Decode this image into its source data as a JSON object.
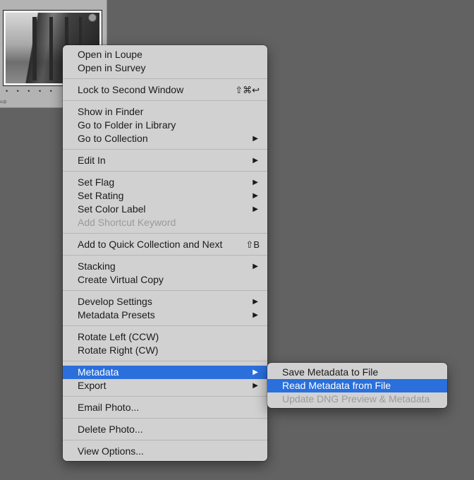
{
  "menu": {
    "groups": [
      [
        {
          "label": "Open in Loupe"
        },
        {
          "label": "Open in Survey"
        }
      ],
      [
        {
          "label": "Lock to Second Window",
          "shortcut": "⇧⌘↩"
        }
      ],
      [
        {
          "label": "Show in Finder"
        },
        {
          "label": "Go to Folder in Library"
        },
        {
          "label": "Go to Collection",
          "submenu": true
        }
      ],
      [
        {
          "label": "Edit In",
          "submenu": true
        }
      ],
      [
        {
          "label": "Set Flag",
          "submenu": true
        },
        {
          "label": "Set Rating",
          "submenu": true
        },
        {
          "label": "Set Color Label",
          "submenu": true
        },
        {
          "label": "Add Shortcut Keyword",
          "disabled": true
        }
      ],
      [
        {
          "label": "Add to Quick Collection and Next",
          "shortcut": "⇧B"
        }
      ],
      [
        {
          "label": "Stacking",
          "submenu": true
        },
        {
          "label": "Create Virtual Copy"
        }
      ],
      [
        {
          "label": "Develop Settings",
          "submenu": true
        },
        {
          "label": "Metadata Presets",
          "submenu": true
        }
      ],
      [
        {
          "label": "Rotate Left (CCW)"
        },
        {
          "label": "Rotate Right (CW)"
        }
      ],
      [
        {
          "label": "Metadata",
          "submenu": true,
          "selected": true
        },
        {
          "label": "Export",
          "submenu": true
        }
      ],
      [
        {
          "label": "Email Photo..."
        }
      ],
      [
        {
          "label": "Delete Photo..."
        }
      ],
      [
        {
          "label": "View Options..."
        }
      ]
    ],
    "arrow_glyph": "▶"
  },
  "submenu": {
    "items": [
      {
        "label": "Save Metadata to File"
      },
      {
        "label": "Read Metadata from File",
        "selected": true
      },
      {
        "label": "Update DNG Preview & Metadata",
        "disabled": true
      }
    ]
  },
  "thumbnail": {
    "rating_dots": "• • • • •",
    "rotate_icon": "⇨"
  },
  "colors": {
    "background": "#626262",
    "menu_bg": "#d1d1d1",
    "highlight": "#2a6fdb",
    "disabled_text": "#9a9a9a"
  }
}
